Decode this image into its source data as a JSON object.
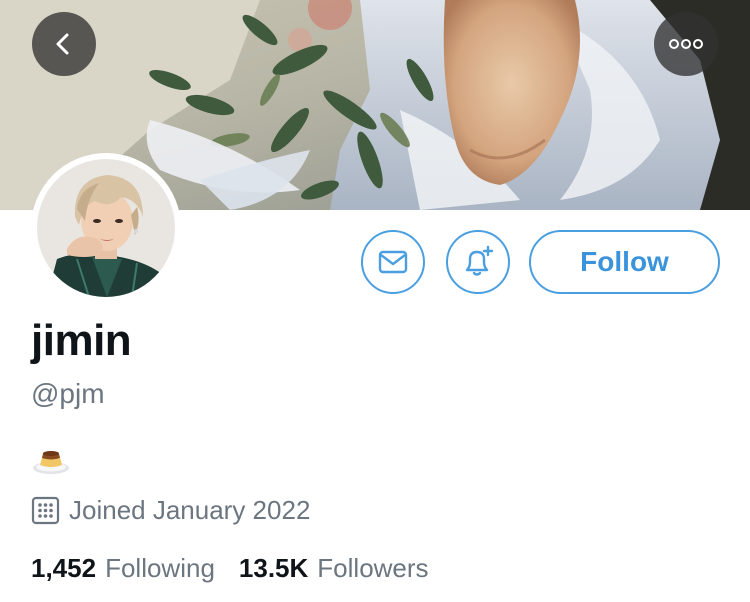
{
  "profile": {
    "display_name": "jimin",
    "handle": "@pjm",
    "bio_emoji_icon": "custard-pudding-icon",
    "joined": "Joined January 2022",
    "following_count": "1,452",
    "following_label": "Following",
    "followers_count": "13.5K",
    "followers_label": "Followers"
  },
  "actions": {
    "follow_label": "Follow",
    "message_icon": "mail-icon",
    "notify_icon": "bell-plus-icon",
    "back_icon": "chevron-left-icon",
    "more_icon": "more-dots-icon"
  },
  "colors": {
    "accent": "#4a9fe0",
    "text_primary": "#0f1419",
    "text_secondary": "#6b7680"
  }
}
